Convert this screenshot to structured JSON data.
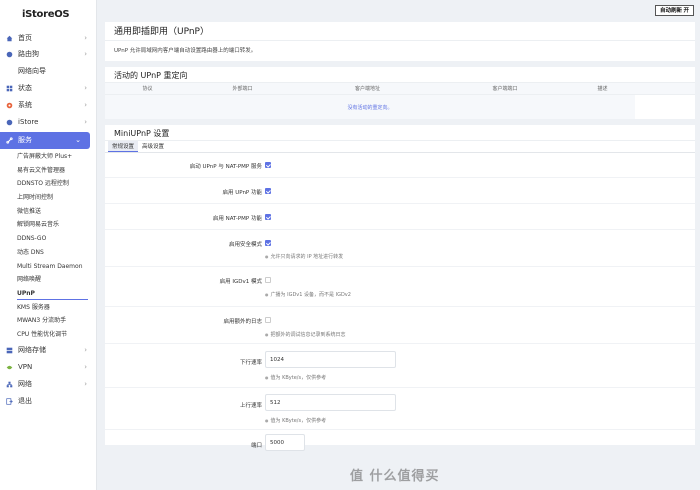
{
  "brand": "iStoreOS",
  "auto_refresh": "自动刷新 开",
  "nav": {
    "home": "首页",
    "router": "路由狗",
    "wizard": "网络向导",
    "status": "状态",
    "system": "系统",
    "istore": "iStore",
    "services": "服务",
    "sub": [
      "广告屏蔽大师 Plus+",
      "易有云文件管理器",
      "DDNSTO 远程控制",
      "上网时间控制",
      "微信推送",
      "解锁网易云音乐",
      "DDNS-GO",
      "动态 DNS",
      "Multi Stream Daemon",
      "网络唤醒",
      "UPnP",
      "KMS 服务器",
      "MWAN3 分流助手",
      "CPU 性能优化调节"
    ],
    "nas": "网络存储",
    "vpn": "VPN",
    "network": "网络",
    "logout": "退出"
  },
  "page": {
    "title": "通用即插即用（UPnP）",
    "description": "UPnP 允许局域网内客户端自动设置路由器上的端口转发。",
    "forwards_title": "活动的 UPnP 重定向",
    "forwards_columns": [
      "协议",
      "外部端口",
      "客户端地址",
      "客户端端口",
      "描述"
    ],
    "forwards_empty": "没有活动的重定向。",
    "settings_title": "MiniUPnP 设置",
    "tabs": [
      "常规设置",
      "高级设置"
    ]
  },
  "settings": {
    "start_service": "启动 UPnP 与 NAT-PMP 服务",
    "enable_upnp": "启用 UPnP 功能",
    "enable_natpmp": "启用 NAT-PMP 功能",
    "secure_mode": "启用安全模式",
    "secure_hint": "允许只向请求的 IP 地址进行转发",
    "igdv1": "启用 IGDv1 模式",
    "igdv1_hint": "广播为 IGDv1 设备，而不是 IGDv2",
    "extra_log": "启用额外的日志",
    "extra_log_hint": "把额外的调试信息记录到系统日志",
    "download": "下行速率",
    "download_value": "1024",
    "download_hint": "值为 KByte/s，仅供参考",
    "upload": "上行速率",
    "upload_value": "512",
    "upload_hint": "值为 KByte/s，仅供参考",
    "port": "端口",
    "port_value": "5000"
  },
  "watermark": "值 什么值得买",
  "colors": {
    "accent": "#5e72e4"
  }
}
